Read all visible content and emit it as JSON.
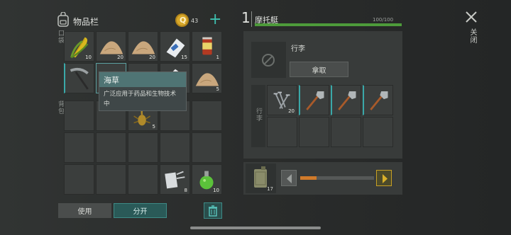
{
  "inventory": {
    "title": "物品栏",
    "coins": "43",
    "plus": "+",
    "pocket_label": "口袋",
    "backpack_label": "背包",
    "slots": [
      {
        "icon": "corn-icon",
        "count": "10"
      },
      {
        "icon": "sand-pile-icon",
        "count": "20"
      },
      {
        "icon": "sand-pile-icon",
        "count": "20"
      },
      {
        "icon": "seed-bag-icon",
        "count": "15"
      },
      {
        "icon": "canned-food-icon",
        "count": "1"
      },
      {
        "icon": "pickaxe-icon",
        "count": ""
      },
      {
        "icon": "seaweed-icon",
        "count": ""
      },
      {
        "icon": "sand-pile-icon",
        "count": ""
      },
      {
        "icon": "paper-icon",
        "count": ""
      },
      {
        "icon": "sand-pile-icon",
        "count": "5"
      }
    ],
    "bp_scorpion_count": "5",
    "bp_bandage_count": "8",
    "bp_potion_count": "10",
    "use_button": "使用",
    "split_button": "分开",
    "trash": "trash-icon"
  },
  "tooltip": {
    "title": "海草",
    "desc": "广泛应用于药品和生物技术中"
  },
  "vehicle": {
    "number": "1",
    "name": "摩托艇",
    "hp": "100/100",
    "hp_fraction": 1.0,
    "luggage_label": "行李",
    "take_button": "拿取",
    "trunk_label": "行李",
    "nails_count": "20",
    "fuel_count": "17"
  },
  "close_label": "关闭",
  "colors": {
    "accent": "#3aa8a8",
    "health": "#4d9b3a",
    "slider": "#d07a2a",
    "arrow": "#c8a024"
  }
}
